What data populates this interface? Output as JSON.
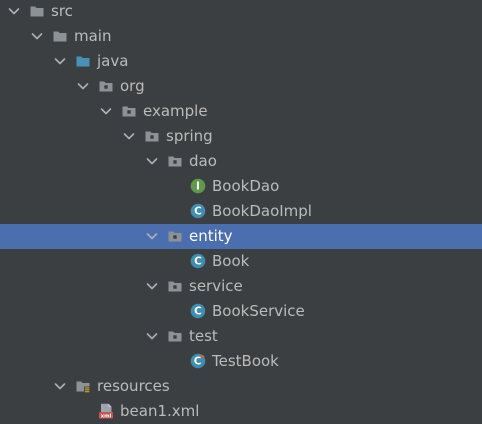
{
  "tree": {
    "selected_index": 9,
    "colors": {
      "background": "#3c3f41",
      "selection": "#4b6eaf",
      "text": "#bbbbbb",
      "folder": "#8c9296",
      "source_folder": "#4a90b8",
      "class_badge": "#3d8eb0",
      "interface_badge": "#5f9a4c"
    },
    "items": [
      {
        "label": "src",
        "depth": 1,
        "type": "folder",
        "expanded": true
      },
      {
        "label": "main",
        "depth": 2,
        "type": "folder",
        "expanded": true
      },
      {
        "label": "java",
        "depth": 3,
        "type": "source-folder",
        "expanded": true
      },
      {
        "label": "org",
        "depth": 4,
        "type": "package",
        "expanded": true
      },
      {
        "label": "example",
        "depth": 5,
        "type": "package",
        "expanded": true
      },
      {
        "label": "spring",
        "depth": 6,
        "type": "package",
        "expanded": true
      },
      {
        "label": "dao",
        "depth": 7,
        "type": "package",
        "expanded": true
      },
      {
        "label": "BookDao",
        "depth": 8,
        "type": "interface"
      },
      {
        "label": "BookDaoImpl",
        "depth": 8,
        "type": "class"
      },
      {
        "label": "entity",
        "depth": 7,
        "type": "package",
        "expanded": true
      },
      {
        "label": "Book",
        "depth": 8,
        "type": "class"
      },
      {
        "label": "service",
        "depth": 7,
        "type": "package",
        "expanded": true
      },
      {
        "label": "BookService",
        "depth": 8,
        "type": "class"
      },
      {
        "label": "test",
        "depth": 7,
        "type": "package",
        "expanded": true
      },
      {
        "label": "TestBook",
        "depth": 8,
        "type": "test-class"
      },
      {
        "label": "resources",
        "depth": 3,
        "type": "resources-folder",
        "expanded": true
      },
      {
        "label": "bean1.xml",
        "depth": 4,
        "type": "xml-file"
      }
    ]
  }
}
